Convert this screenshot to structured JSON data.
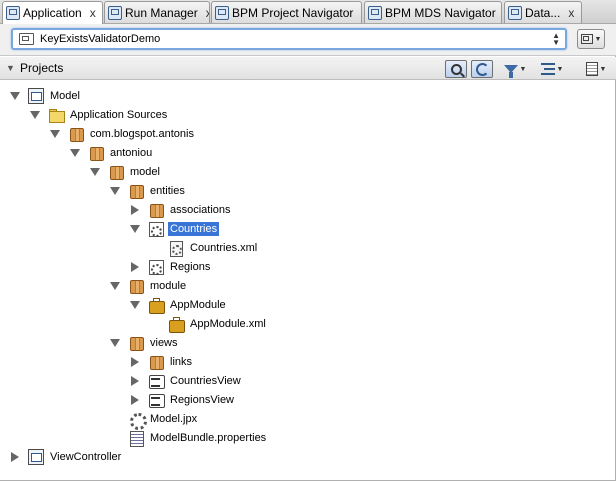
{
  "tabs": [
    {
      "label": "Application",
      "icon": "application-navigator-icon",
      "active": true
    },
    {
      "label": "Run Manager",
      "icon": "run-manager-icon",
      "active": false
    },
    {
      "label": "BPM Project Navigator",
      "icon": "bpm-project-navigator-icon",
      "active": false
    },
    {
      "label": "BPM MDS Navigator",
      "icon": "bpm-mds-navigator-icon",
      "active": false
    },
    {
      "label": "Data...",
      "icon": "data-icon",
      "active": false
    }
  ],
  "tab_close_glyph": "x",
  "application_selector": {
    "value": "KeyExistsValidatorDemo",
    "icon": "application-icon"
  },
  "projects_panel": {
    "label": "Projects"
  },
  "tree": {
    "model": "Model",
    "application_sources": "Application Sources",
    "pkg_blogspot": "com.blogspot.antonis",
    "pkg_antoniou": "antoniou",
    "pkg_model": "model",
    "pkg_entities": "entities",
    "pkg_associations": "associations",
    "entity_countries": "Countries",
    "file_countries_xml": "Countries.xml",
    "entity_regions": "Regions",
    "pkg_module": "module",
    "appmodule": "AppModule",
    "file_appmodule_xml": "AppModule.xml",
    "pkg_views": "views",
    "pkg_links": "links",
    "view_countries": "CountriesView",
    "view_regions": "RegionsView",
    "file_model_jpx": "Model.jpx",
    "file_modelbundle": "ModelBundle.properties",
    "viewcontroller": "ViewController"
  },
  "colors": {
    "selection": "#3875d7",
    "accent": "#7aa7de"
  }
}
